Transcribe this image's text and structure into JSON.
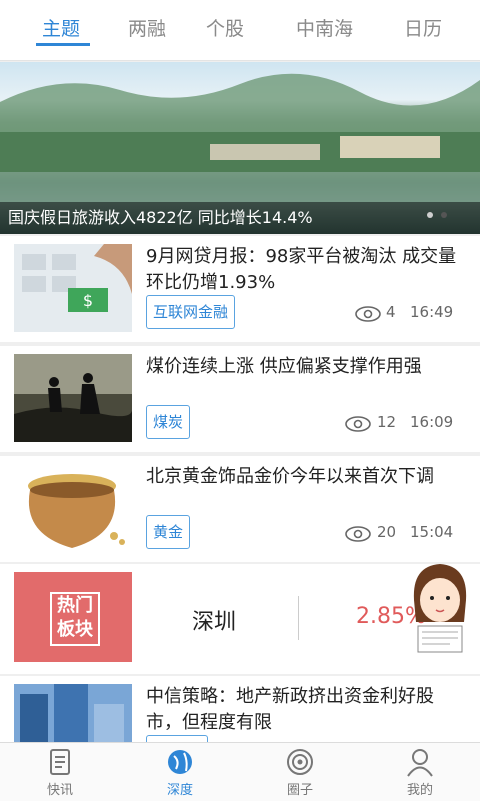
{
  "top_tabs": [
    {
      "label": "主题",
      "active": true
    },
    {
      "label": "两融"
    },
    {
      "label": "个股"
    },
    {
      "label": "中南海"
    },
    {
      "label": "日历"
    }
  ],
  "banner": {
    "caption": "国庆假日旅游收入4822亿 同比增长14.4%"
  },
  "articles": [
    {
      "title": "9月网贷月报：98家平台被淘汰 成交量环比仍增1.93%",
      "tag": "互联网金融",
      "views": "4",
      "time": "16:49"
    },
    {
      "title": "煤价连续上涨 供应偏紧支撑作用强",
      "tag": "煤炭",
      "views": "12",
      "time": "16:09"
    },
    {
      "title": "北京黄金饰品金价今年以来首次下调",
      "tag": "黄金",
      "views": "20",
      "time": "15:04"
    }
  ],
  "hot_sector": {
    "badge": "热门板块",
    "badge_line1": "热门",
    "badge_line2": "板块",
    "city": "深圳",
    "change": "2.85%"
  },
  "last_article": {
    "title": "中信策略：地产新政挤出资金利好股市，但程度有限"
  },
  "bottom_nav": [
    {
      "label": "快讯"
    },
    {
      "label": "深度",
      "active": true
    },
    {
      "label": "圈子"
    },
    {
      "label": "我的"
    }
  ],
  "colors": {
    "accent": "#2f86d6",
    "hot": "#e26b6b",
    "positive": "#e05a5a"
  }
}
